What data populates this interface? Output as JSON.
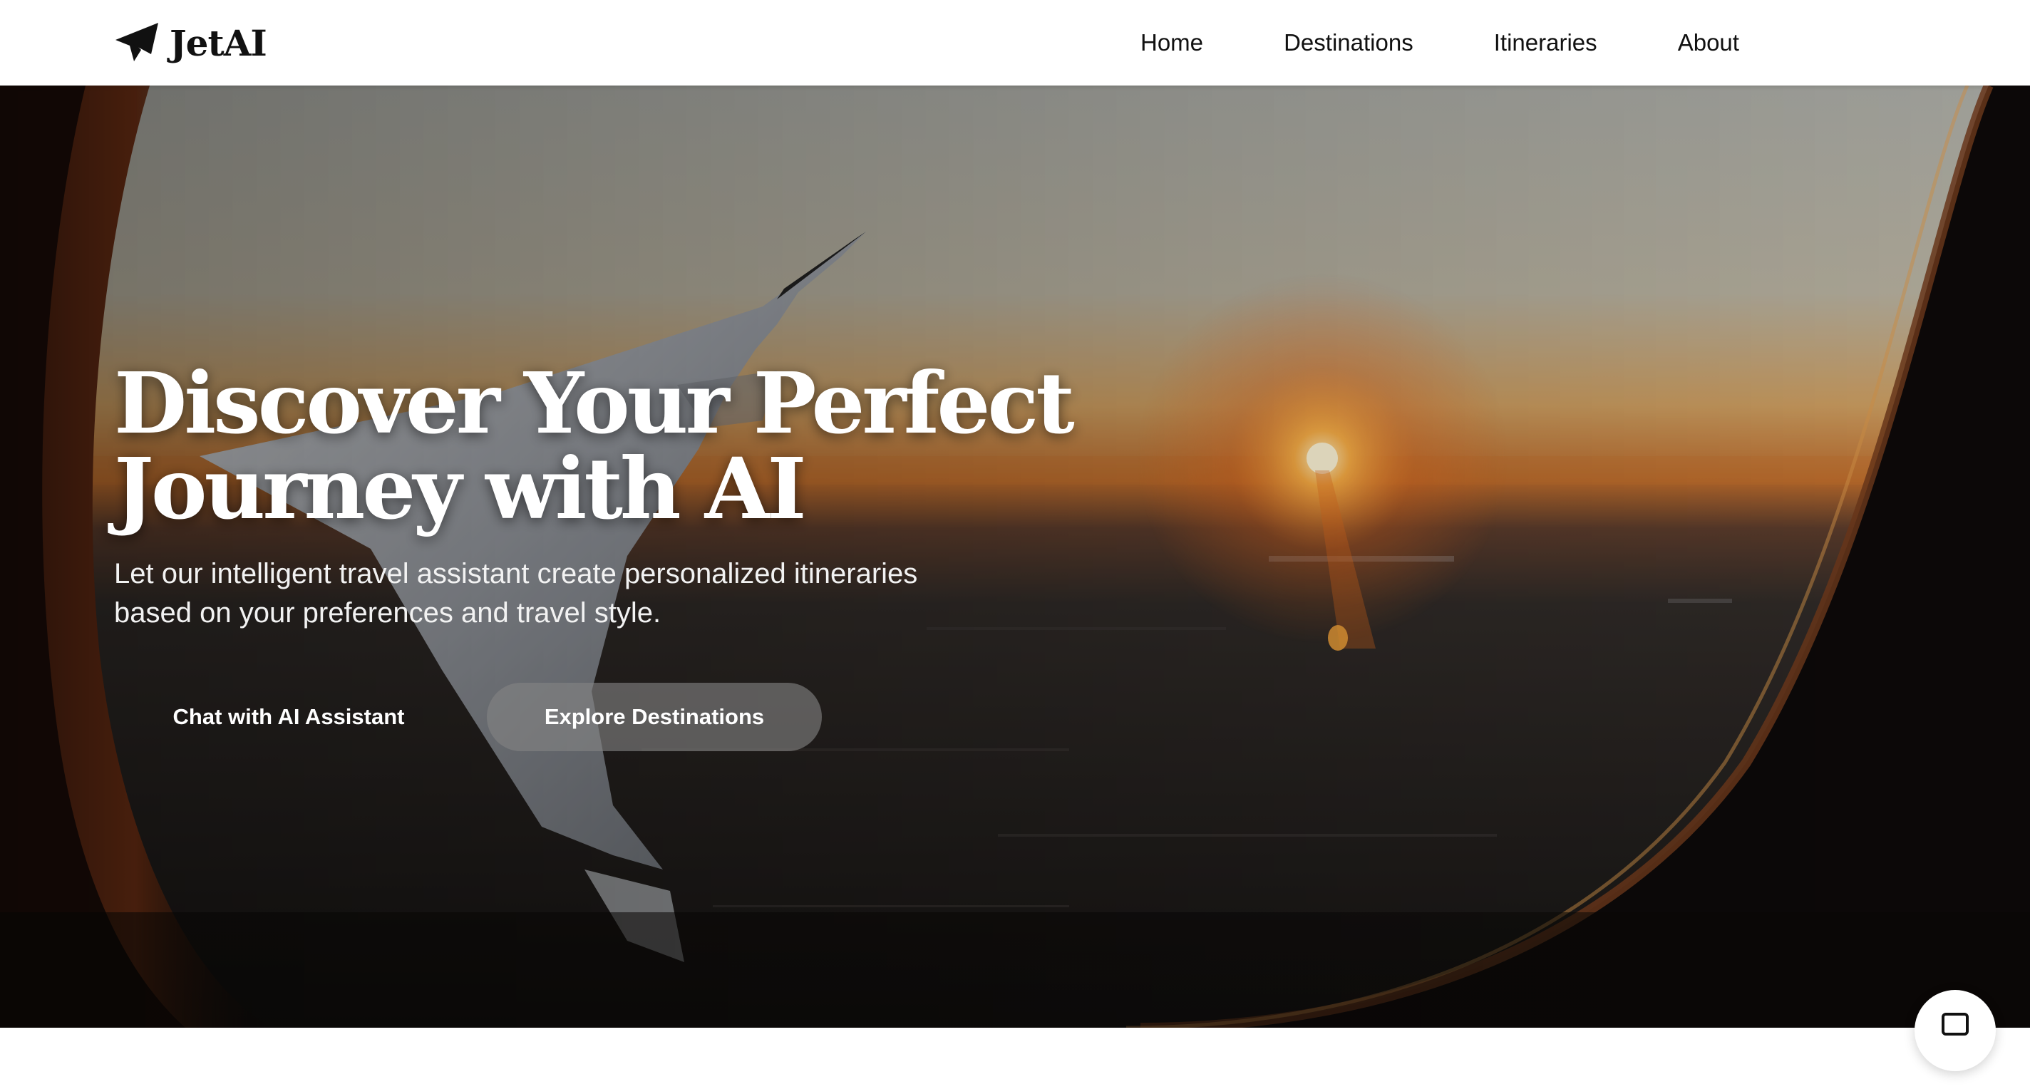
{
  "header": {
    "logo_text": "JetAI",
    "nav": [
      "Home",
      "Destinations",
      "Itineraries",
      "About"
    ]
  },
  "hero": {
    "title_lines": [
      "Discover Your Perfect",
      "Journey with AI"
    ],
    "subtitle": "Let our intelligent travel assistant create personalized itineraries based on your preferences and travel style.",
    "primary_button": "Chat with AI Assistant",
    "secondary_button": "Explore Destinations",
    "background": "airplane-window-sunset-image"
  },
  "icons": {
    "logo": "paper-plane-icon",
    "chat_fab": "chat-bubble-icon"
  },
  "colors": {
    "text_dark": "#111111",
    "hero_text": "#ffffff",
    "secondary_button_bg": "#828282"
  }
}
